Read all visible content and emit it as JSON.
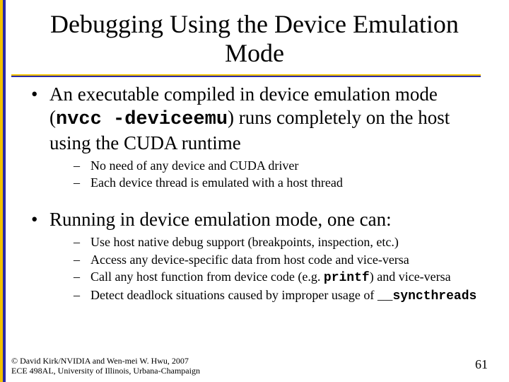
{
  "title": "Debugging Using the Device Emulation Mode",
  "bullets": [
    {
      "pre": "An executable compiled in ",
      "kw": "device emulation mode",
      "mid": " (",
      "code": "nvcc -deviceemu",
      "post": ") runs completely on the host using the CUDA runtime",
      "subs": [
        "No need of any device and CUDA driver",
        "Each device thread is emulated with a host thread"
      ]
    },
    {
      "text": "Running in device emulation mode, one can:",
      "subs": [
        "Use host native debug support (breakpoints, inspection, etc.)",
        "Access any device-specific data from host code and vice-versa",
        {
          "pre": "Call any host function from device code (e.g. ",
          "code": "printf",
          "post": ") and vice-versa"
        },
        {
          "pre": "Detect deadlock situations caused by improper usage of ",
          "code": "__syncthreads"
        }
      ]
    }
  ],
  "footer": {
    "line1": "© David Kirk/NVIDIA and Wen-mei W. Hwu, 2007",
    "line2": "ECE 498AL, University of Illinois, Urbana-Champaign",
    "page": "61"
  }
}
